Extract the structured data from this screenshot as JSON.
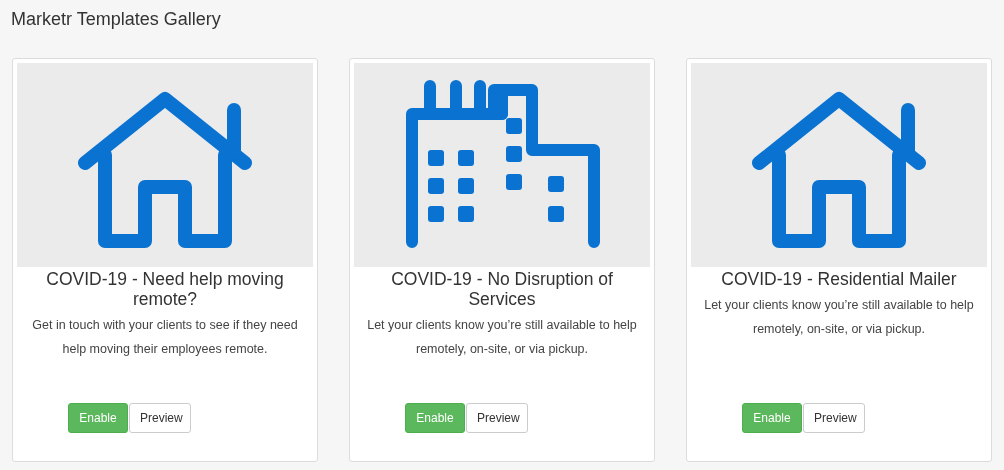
{
  "page_title": "Marketr Templates Gallery",
  "cards": [
    {
      "kind": "house",
      "title": "COVID-19 - Need help moving remote?",
      "description": "Get in touch with your clients to see if they need help moving their employees remote.",
      "buttons": [
        {
          "kind": "primary",
          "label": "Enable"
        },
        {
          "kind": "default",
          "label": "Preview"
        }
      ]
    },
    {
      "kind": "building",
      "title": "COVID-19 - No Disruption of Services",
      "description": "Let your clients know you’re still available to help remotely, on-site, or via pickup.",
      "buttons": [
        {
          "kind": "primary",
          "label": "Enable"
        },
        {
          "kind": "default",
          "label": "Preview"
        }
      ]
    },
    {
      "kind": "house",
      "title": "COVID-19 - Residential Mailer",
      "description": "Let your clients know you’re still available to help remotely, on-site, or via pickup.",
      "buttons": [
        {
          "kind": "primary",
          "label": "Enable"
        },
        {
          "kind": "default",
          "label": "Preview"
        }
      ]
    }
  ]
}
